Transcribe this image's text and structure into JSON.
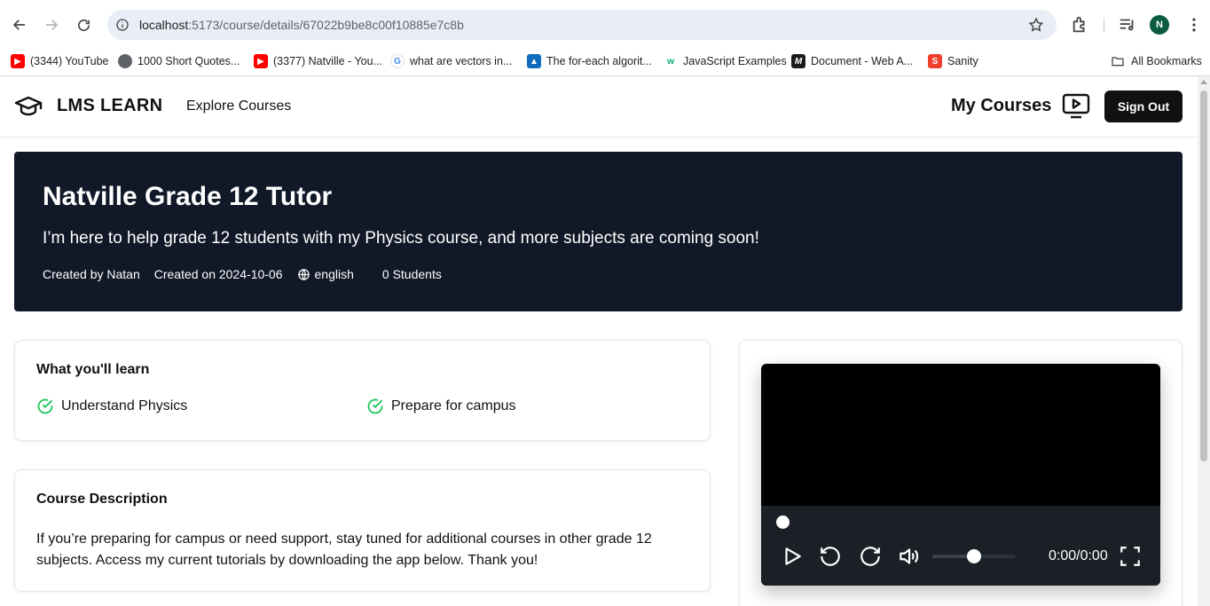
{
  "browser": {
    "url_host": "localhost",
    "url_path": ":5173/course/details/67022b9be8c00f10885e7c8b",
    "profile_initial": "N",
    "bookmarks": [
      {
        "label": "(3344) YouTube",
        "icon": "youtube-icon",
        "color": "#ff0000"
      },
      {
        "label": "1000 Short Quotes...",
        "icon": "globe-icon",
        "color": "#5f6368"
      },
      {
        "label": "(3377) Natville - You...",
        "icon": "youtube-icon",
        "color": "#ff0000"
      },
      {
        "label": "what are vectors in...",
        "icon": "google-icon",
        "color": "#4285f4"
      },
      {
        "label": "The for-each algorit...",
        "icon": "azure-icon",
        "color": "#0f6cbd"
      },
      {
        "label": "JavaScript Examples",
        "icon": "w3schools-icon",
        "color": "#04aa6d"
      },
      {
        "label": "Document - Web A...",
        "icon": "mdn-icon",
        "color": "#1b1b1b"
      },
      {
        "label": "Sanity",
        "icon": "sanity-icon",
        "color": "#f03e2f"
      }
    ],
    "all_bookmarks": "All Bookmarks"
  },
  "header": {
    "logo": "LMS LEARN",
    "explore": "Explore Courses",
    "my_courses": "My Courses",
    "sign_out": "Sign Out"
  },
  "course": {
    "title": "Natville Grade 12 Tutor",
    "subtitle": "I’m here to help grade 12 students with my Physics course, and more subjects are coming soon!",
    "created_by": "Created by Natan",
    "created_on": "Created on 2024-10-06",
    "language": "english",
    "students": "0 Students"
  },
  "learn": {
    "title": "What you'll learn",
    "items": [
      "Understand Physics",
      "Prepare for campus"
    ]
  },
  "description": {
    "title": "Course Description",
    "text": "If you’re preparing for campus or need support, stay tuned for additional courses in other grade 12 subjects. Access my current tutorials by downloading the app below. Thank you!"
  },
  "player": {
    "time": "0:00/0:00",
    "progress": 0,
    "volume": 0.5
  },
  "colors": {
    "hero_bg": "#111827",
    "check": "#22c55e",
    "button_bg": "#111111"
  }
}
